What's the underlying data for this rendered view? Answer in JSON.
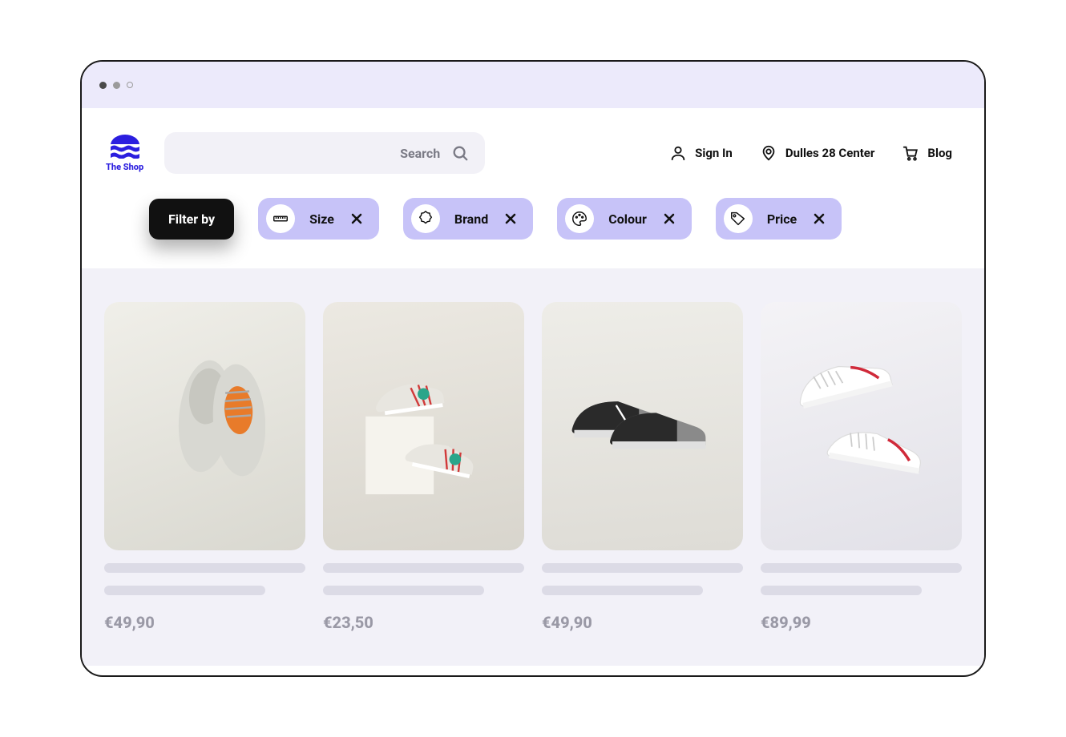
{
  "brand": {
    "name": "The Shop"
  },
  "search": {
    "placeholder": "Search"
  },
  "header": {
    "sign_in": "Sign In",
    "location": "Dulles 28 Center",
    "blog": "Blog"
  },
  "filters": {
    "label": "Filter by",
    "items": [
      {
        "label": "Size",
        "icon": "ruler-icon"
      },
      {
        "label": "Brand",
        "icon": "badge-icon"
      },
      {
        "label": "Colour",
        "icon": "palette-icon"
      },
      {
        "label": "Price",
        "icon": "tag-icon"
      }
    ]
  },
  "products": [
    {
      "price": "€49,90",
      "colors": {
        "a": "#d8d8d2",
        "b": "#c0c0b8",
        "c": "#e87b2a"
      }
    },
    {
      "price": "€23,50",
      "colors": {
        "a": "#e8e6e0",
        "b": "#d13a3a",
        "c": "#2aa58a"
      }
    },
    {
      "price": "€49,90",
      "colors": {
        "a": "#2a2a2a",
        "b": "#e0e0e0",
        "c": "#8a8a8a"
      }
    },
    {
      "price": "€89,99",
      "colors": {
        "a": "#f4f4f4",
        "b": "#ffffff",
        "c": "#d02a3a"
      }
    }
  ]
}
